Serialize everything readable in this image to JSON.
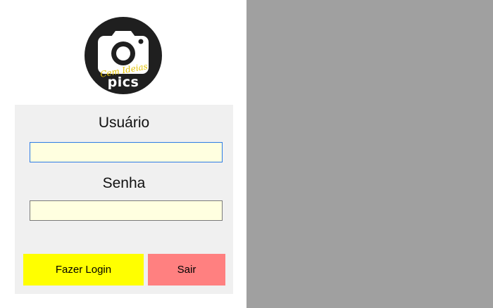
{
  "logo": {
    "script_text": "Cem Ideias",
    "word_text": "pics",
    "icon": "camera-icon",
    "colors": {
      "background": "#1f1f1f",
      "script": "#e3c100",
      "icon": "#ffffff"
    }
  },
  "form": {
    "user_label": "Usuário",
    "user_value": "",
    "password_label": "Senha",
    "password_value": "",
    "login_label": "Fazer Login",
    "exit_label": "Sair"
  },
  "colors": {
    "input_background": "#ffffe0",
    "login_button": "#ffff00",
    "exit_button": "#ff8080",
    "right_pane": "#a0a0a0",
    "panel": "#f0f0f0"
  }
}
